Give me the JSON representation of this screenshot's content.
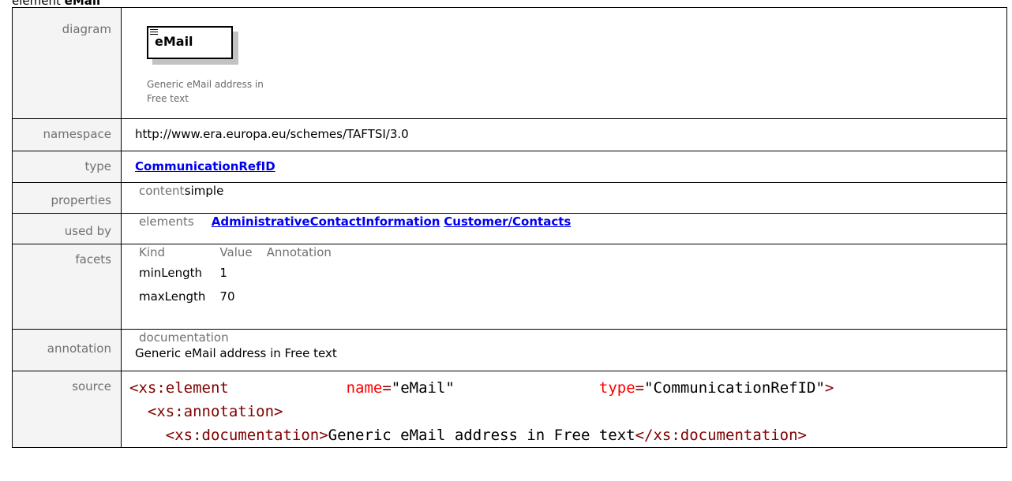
{
  "page_heading": {
    "prefix": "element",
    "name": "eMail"
  },
  "labels": {
    "diagram": "diagram",
    "namespace": "namespace",
    "type": "type",
    "properties": "properties",
    "used_by": "used by",
    "facets": "facets",
    "annotation": "annotation",
    "source": "source"
  },
  "diagram": {
    "element_name": "eMail",
    "doc_line1": "Generic eMail address in",
    "doc_line2": "Free text"
  },
  "namespace": "http://www.era.europa.eu/schemes/TAFTSI/3.0",
  "type_link": "CommunicationRefID",
  "properties": {
    "key": "content",
    "value": "simple"
  },
  "used_by": {
    "key": "elements",
    "links": [
      "AdministrativeContactInformation",
      "Customer/Contacts"
    ]
  },
  "facets": {
    "headers": [
      "Kind",
      "Value",
      "Annotation"
    ],
    "rows": [
      {
        "kind": "minLength",
        "value": "1"
      },
      {
        "kind": "maxLength",
        "value": "70"
      }
    ]
  },
  "annotation": {
    "heading": "documentation",
    "text": "Generic eMail address in Free text"
  },
  "source": {
    "tag_open": "<xs:element",
    "attr_name": "name",
    "attr_name_eq": "=",
    "attr_name_val": "\"eMail\"",
    "attr_type": "type",
    "attr_type_eq": "=",
    "attr_type_val": "\"CommunicationRefID\"",
    "tag_close": ">",
    "annot_open": "<xs:annotation>",
    "doc_open": "<xs:documentation>",
    "doc_text": "Generic eMail address in Free text",
    "doc_close": "</xs:documentation>"
  },
  "colors": {
    "label_text": "#707070",
    "label_bg": "#f4f4f4",
    "link": "#0000ee",
    "xml_tag": "#800000",
    "xml_attr": "#ff0000"
  }
}
